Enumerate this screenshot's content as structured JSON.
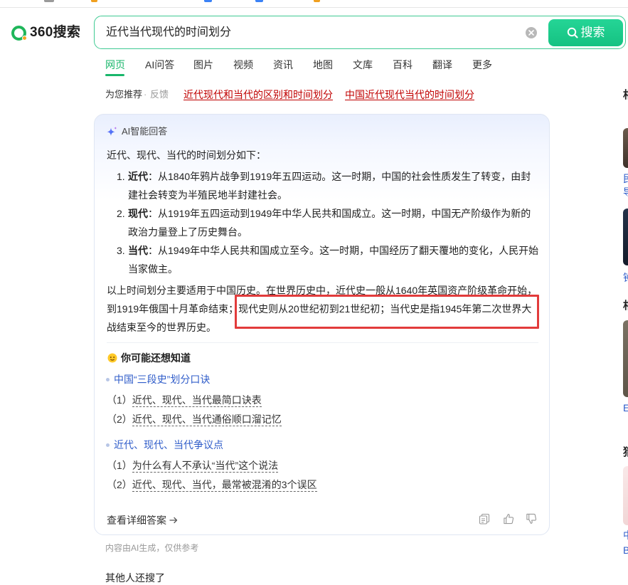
{
  "header": {
    "logo_text": "360搜索",
    "query": "近代当代现代的时间划分",
    "button_label": "搜索"
  },
  "tabs": [
    {
      "label": "网页",
      "active": true
    },
    {
      "label": "AI问答"
    },
    {
      "label": "图片"
    },
    {
      "label": "视频"
    },
    {
      "label": "资讯"
    },
    {
      "label": "地图"
    },
    {
      "label": "文库"
    },
    {
      "label": "百科"
    },
    {
      "label": "翻译"
    },
    {
      "label": "更多"
    }
  ],
  "recommend": {
    "label": "为您推荐",
    "separator": "·",
    "feedback": "反馈",
    "links": [
      "近代现代和当代的区别和时间划分",
      "中国近代现代当代的时间划分"
    ]
  },
  "ai_card": {
    "title": "AI智能回答",
    "intro": "近代、现代、当代的时间划分如下：",
    "items": [
      {
        "num": "1.",
        "label": "近代",
        "text": "：从1840年鸦片战争到1919年五四运动。这一时期，中国的社会性质发生了转变，由封建社会转变为半殖民地半封建社会。"
      },
      {
        "num": "2.",
        "label": "现代",
        "text": "：从1919年五四运动到1949年中华人民共和国成立。这一时期，中国无产阶级作为新的政治力量登上了历史舞台。"
      },
      {
        "num": "3.",
        "label": "当代",
        "text": "：从1949年中华人民共和国成立至今。这一时期，中国经历了翻天覆地的变化，人民开始当家做主。"
      }
    ],
    "summary": "以上时间划分主要适用于中国历史。在世界历史中，近代史一般从1640年英国资产阶级革命开始，到1919年俄国十月革命结束；现代史则从20世纪初到21世纪初；当代史是指1945年第二次世界大战结束至今的世界历史。",
    "related_title": "你可能还想知道",
    "related_groups": [
      {
        "title": "中国“三段史”划分口诀",
        "items": [
          {
            "num": "（1）",
            "text": "近代、现代、当代最简口诀表"
          },
          {
            "num": "（2）",
            "text": "近代、现代、当代通俗顺口溜记忆"
          }
        ]
      },
      {
        "title": "近代、现代、当代争议点",
        "items": [
          {
            "num": "（1）",
            "text": "为什么有人不承认“当代”这个说法"
          },
          {
            "num": "（2）",
            "text": "近代、现代、当代，最常被混淆的3个误区"
          }
        ]
      }
    ],
    "detail_link": "查看详细答案"
  },
  "disclaimer": "内容由AI生成，仅供参考",
  "others_searched": "其他人还搜了",
  "side_panel": {
    "glyphs": [
      "相",
      "民",
      "导",
      "钟",
      "相",
      "E",
      "猜",
      "中",
      "B"
    ]
  },
  "icons": {
    "logo": "360-logo-icon",
    "clear": "clear-icon",
    "search": "magnifier-icon",
    "ai": "sparkle-icon",
    "related": "emoji-icon",
    "detail_arrow": "arrow-right-icon",
    "actions": [
      "copy-icon",
      "thumbs-up-icon",
      "thumbs-down-icon"
    ]
  },
  "colors": {
    "accent_green": "#19b66b",
    "button_green": "#1ccb8a",
    "recommend_link_red": "#c00000",
    "related_link_blue": "#2f5cc9",
    "highlight_box_red": "#e23b3b"
  }
}
